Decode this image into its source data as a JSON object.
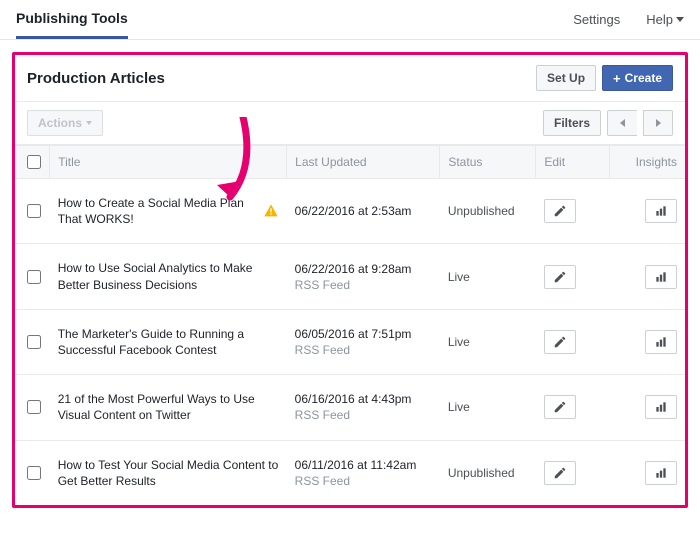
{
  "topbar": {
    "active_tab": "Publishing Tools",
    "settings_label": "Settings",
    "help_label": "Help"
  },
  "panel": {
    "title": "Production Articles",
    "setup_label": "Set Up",
    "create_label": "Create",
    "actions_label": "Actions",
    "filters_label": "Filters"
  },
  "columns": {
    "title": "Title",
    "updated": "Last Updated",
    "status": "Status",
    "edit": "Edit",
    "insights": "Insights"
  },
  "rows": [
    {
      "title": "How to Create a Social Media Plan That WORKS!",
      "warning": true,
      "updated": "06/22/2016 at 2:53am",
      "source": "",
      "status": "Unpublished"
    },
    {
      "title": "How to Use Social Analytics to Make Better Business Decisions",
      "warning": false,
      "updated": "06/22/2016 at 9:28am",
      "source": "RSS Feed",
      "status": "Live"
    },
    {
      "title": "The Marketer's Guide to Running a Successful Facebook Contest",
      "warning": false,
      "updated": "06/05/2016 at 7:51pm",
      "source": "RSS Feed",
      "status": "Live"
    },
    {
      "title": "21 of the Most Powerful Ways to Use Visual Content on Twitter",
      "warning": false,
      "updated": "06/16/2016 at 4:43pm",
      "source": "RSS Feed",
      "status": "Live"
    },
    {
      "title": "How to Test Your Social Media Content to Get Better Results",
      "warning": false,
      "updated": "06/11/2016 at 11:42am",
      "source": "RSS Feed",
      "status": "Unpublished"
    }
  ]
}
